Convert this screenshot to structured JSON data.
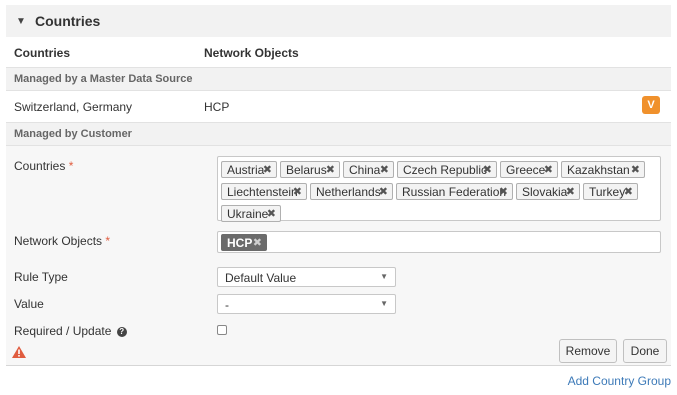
{
  "panel": {
    "toggle_icon": "triangle-down",
    "title": "Countries"
  },
  "columns": {
    "countries": "Countries",
    "network_objects": "Network Objects"
  },
  "master": {
    "section_label": "Managed by a Master Data Source",
    "countries": "Switzerland, Germany",
    "network_objects": "HCP",
    "badge": "V",
    "badge_color": "#f0912c"
  },
  "customer": {
    "section_label": "Managed by Customer",
    "countries_label": "Countries",
    "required_mark": "*",
    "country_tags": [
      "Austria",
      "Belarus",
      "China",
      "Czech Republic",
      "Greece",
      "Kazakhstan",
      "Liechtenstein",
      "Netherlands",
      "Russian Federation",
      "Slovakia",
      "Turkey",
      "Ukraine"
    ],
    "network_objects_label": "Network Objects",
    "network_tags": [
      "HCP"
    ],
    "remove_glyph": "✖",
    "rule_type_label": "Rule Type",
    "rule_type_value": "Default Value",
    "value_label": "Value",
    "value_value": "-",
    "required_update_label": "Required / Update",
    "required_update_checked": false,
    "help_icon": "?",
    "caret": "▼",
    "warning_color": "#e05c3f",
    "remove_button": "Remove",
    "done_button": "Done"
  },
  "add_country_group": "Add Country Group",
  "link_color": "#3d7ab8"
}
